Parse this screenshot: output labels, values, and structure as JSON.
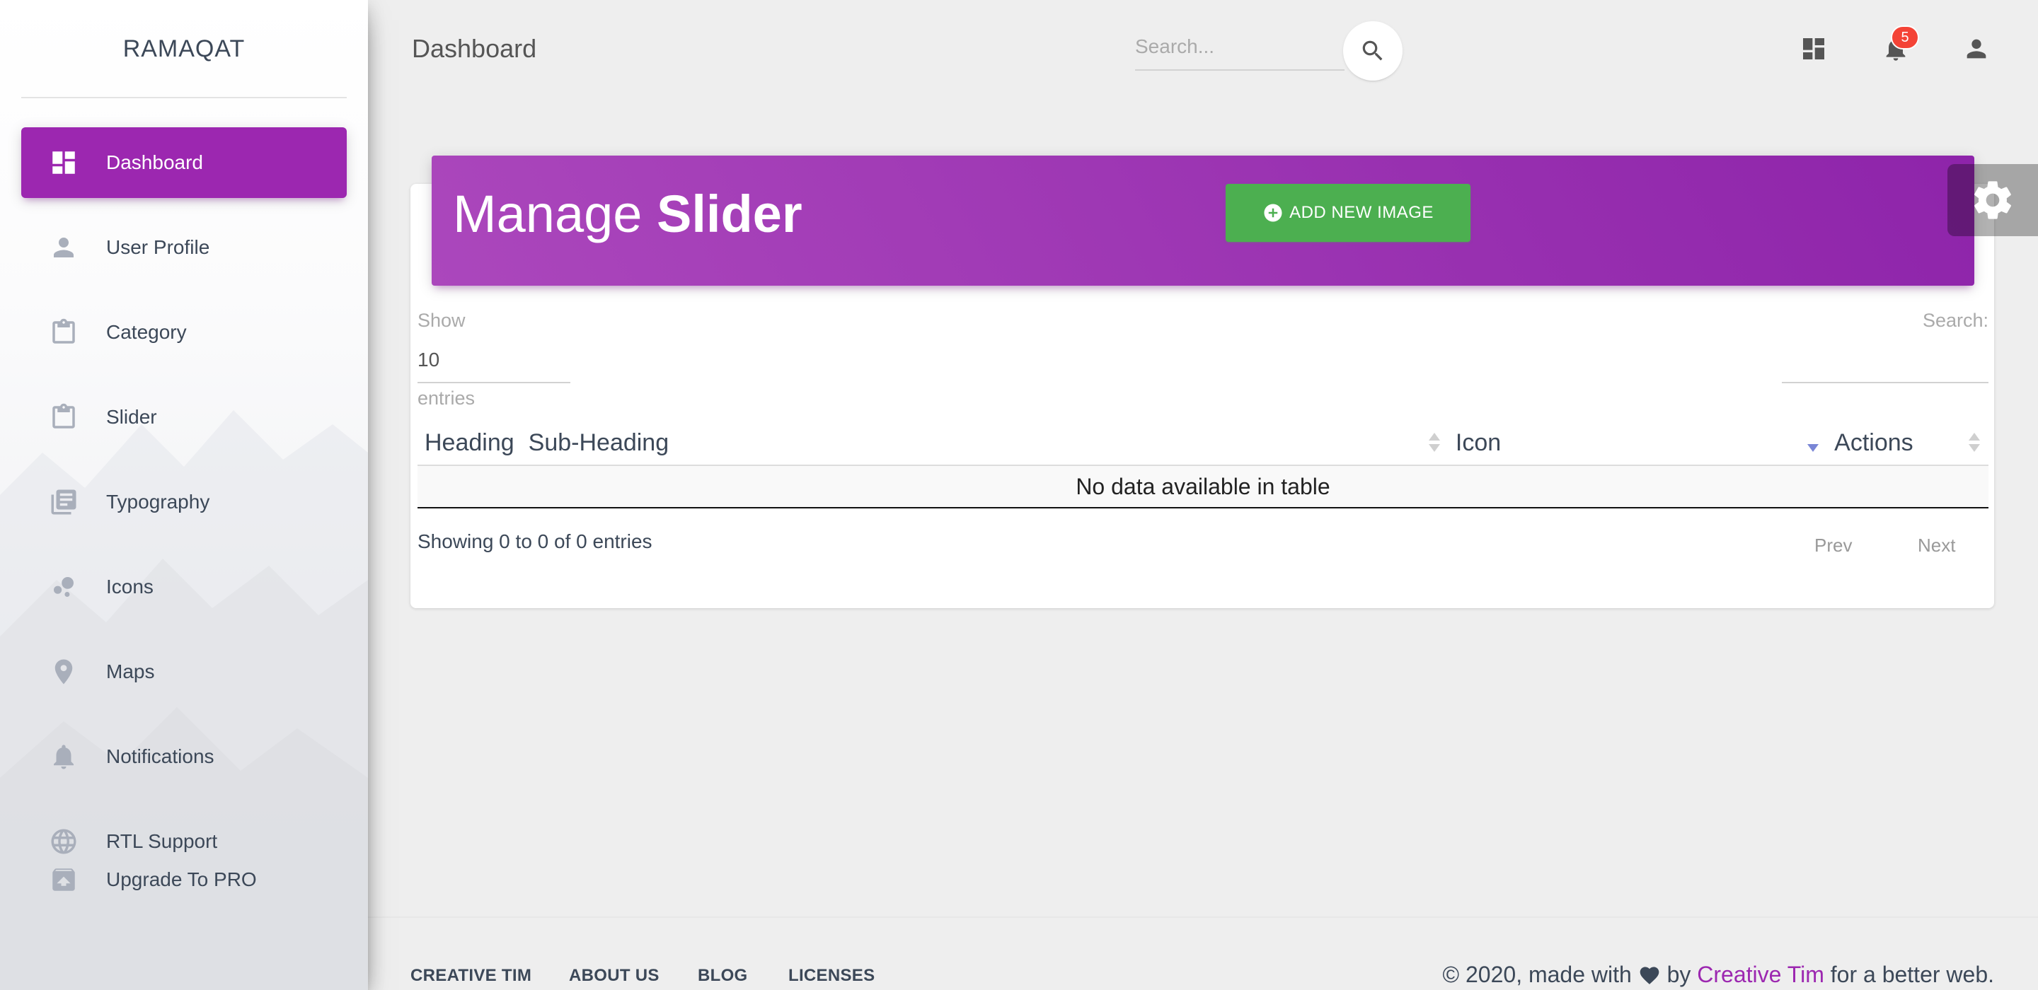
{
  "brand": "RAMAQAT",
  "sidebar": {
    "items": [
      {
        "label": "Dashboard"
      },
      {
        "label": "User Profile"
      },
      {
        "label": "Category"
      },
      {
        "label": "Slider"
      },
      {
        "label": "Typography"
      },
      {
        "label": "Icons"
      },
      {
        "label": "Maps"
      },
      {
        "label": "Notifications"
      },
      {
        "label": "RTL Support"
      },
      {
        "label": "Upgrade To PRO"
      }
    ],
    "active_index": 0
  },
  "topbar": {
    "page_name": "Dashboard",
    "search_placeholder": "Search...",
    "notification_count": "5"
  },
  "card": {
    "title_light": "Manage ",
    "title_bold": "Slider",
    "add_button_label": "ADD NEW IMAGE"
  },
  "datatable": {
    "show_label": "Show",
    "length_value": "10",
    "entries_label": "entries",
    "search_label": "Search:",
    "columns": [
      "Heading",
      "Sub-Heading",
      "Icon",
      "Actions"
    ],
    "empty_message": "No data available in table",
    "info": "Showing 0 to 0 of 0 entries",
    "prev_label": "Prev",
    "next_label": "Next"
  },
  "footer": {
    "links": [
      "CREATIVE TIM",
      "ABOUT US",
      "BLOG",
      "LICENSES"
    ],
    "copyright_prefix": "© 2020, made with",
    "copyright_by": "by",
    "copyright_author": "Creative Tim",
    "copyright_suffix": "for a better web."
  },
  "colors": {
    "primary": "#9c27b0",
    "success": "#4caf50",
    "danger": "#f44336"
  }
}
